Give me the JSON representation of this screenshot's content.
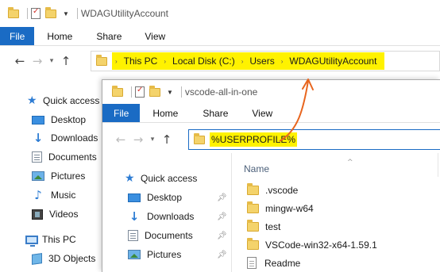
{
  "back_window": {
    "title": "WDAGUtilityAccount",
    "tabs": [
      "File",
      "Home",
      "Share",
      "View"
    ],
    "breadcrumb": [
      "This PC",
      "Local Disk (C:)",
      "Users",
      "WDAGUtilityAccount"
    ],
    "sidebar": {
      "quick_access": "Quick access",
      "items": [
        "Desktop",
        "Downloads",
        "Documents",
        "Pictures",
        "Music",
        "Videos"
      ],
      "this_pc": "This PC",
      "objects_3d": "3D Objects"
    }
  },
  "front_window": {
    "title": "vscode-all-in-one",
    "tabs": [
      "File",
      "Home",
      "Share",
      "View"
    ],
    "address_value": "%USERPROFILE%",
    "sidebar": {
      "quick_access": "Quick access",
      "items": [
        "Desktop",
        "Downloads",
        "Documents",
        "Pictures"
      ]
    },
    "column_header": "Name",
    "files": [
      ".vscode",
      "mingw-w64",
      "test",
      "VSCode-win32-x64-1.59.1",
      "Readme"
    ]
  },
  "colors": {
    "highlight": "#fff200",
    "arrow": "#e8651e",
    "file_tab": "#1a6bc4"
  }
}
